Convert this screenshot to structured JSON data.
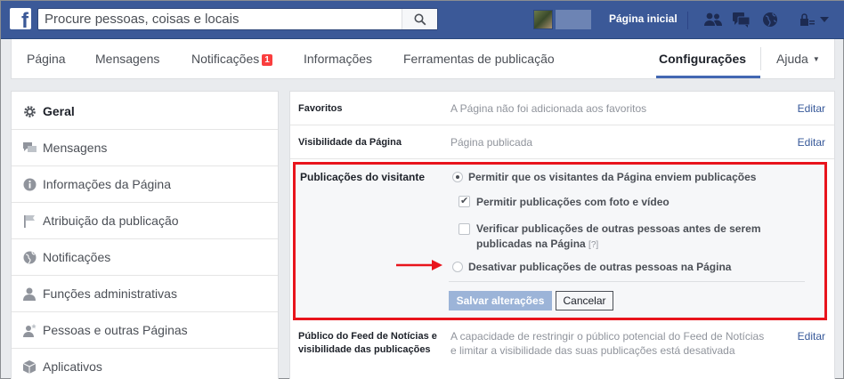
{
  "topbar": {
    "logo": "f",
    "search_placeholder": "Procure pessoas, coisas e locais",
    "home_link": "Página inicial",
    "icons": [
      "search-icon",
      "friends-icon",
      "messages-icon",
      "globe-icon",
      "lock-icon",
      "caret-down-icon"
    ]
  },
  "page_nav": {
    "items": [
      "Página",
      "Mensagens",
      "Notificações",
      "Informações",
      "Ferramentas de publicação",
      "Configurações",
      "Ajuda"
    ],
    "notifications_badge": "1"
  },
  "sidebar": {
    "items": [
      {
        "label": "Geral",
        "icon": "gear-icon"
      },
      {
        "label": "Mensagens",
        "icon": "messages-icon"
      },
      {
        "label": "Informações da Página",
        "icon": "info-icon"
      },
      {
        "label": "Atribuição da publicação",
        "icon": "flag-icon"
      },
      {
        "label": "Notificações",
        "icon": "globe-icon"
      },
      {
        "label": "Funções administrativas",
        "icon": "person-icon"
      },
      {
        "label": "Pessoas e outras Páginas",
        "icon": "person-star-icon"
      },
      {
        "label": "Aplicativos",
        "icon": "cube-icon"
      }
    ]
  },
  "settings": {
    "rows": [
      {
        "label": "Favoritos",
        "value": "A Página não foi adicionada aos favoritos",
        "edit": "Editar"
      },
      {
        "label": "Visibilidade da Página",
        "value": "Página publicada",
        "edit": "Editar"
      }
    ],
    "visitor_posts": {
      "label": "Publicações do visitante",
      "option_allow": "Permitir que os visitantes da Página enviem publicações",
      "option_photo_video": "Permitir publicações com foto e vídeo",
      "option_review_1": "Verificar publicações de outras pessoas antes de serem",
      "option_review_2": "publicadas na Página",
      "help": "[?]",
      "option_disable": "Desativar publicações de outras pessoas na Página",
      "save_button": "Salvar alterações",
      "cancel_button": "Cancelar"
    },
    "news_feed_row": {
      "label_1": "Público do Feed de Notícias e",
      "label_2": "visibilidade das publicações",
      "value_1": "A capacidade de restringir o público potencial do Feed de Notícias",
      "value_2": "e limitar a visibilidade das suas publicações está desativada",
      "edit": "Editar"
    }
  },
  "colors": {
    "brand_blue": "#3b5998",
    "highlight_red": "#e8141c",
    "link": "#365899"
  }
}
